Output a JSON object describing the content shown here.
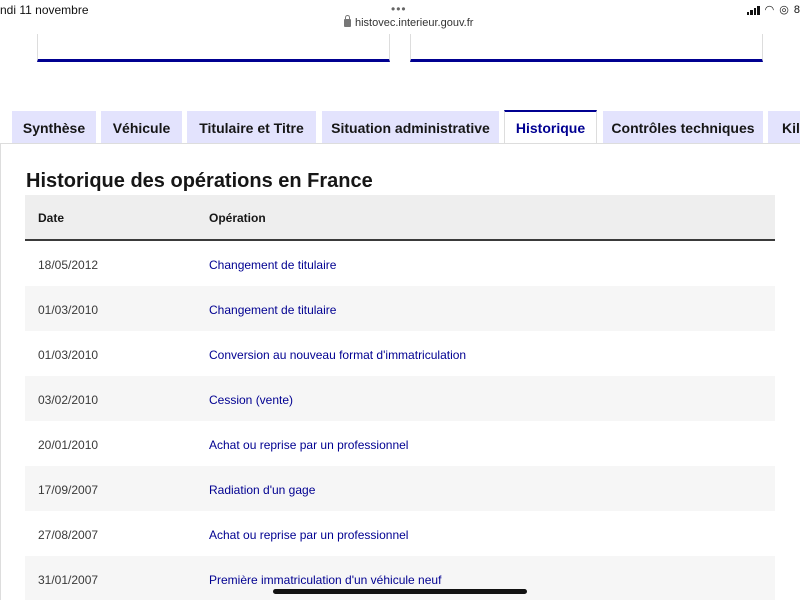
{
  "status_bar": {
    "date": "ndi 11 novembre",
    "dots": "•••",
    "url": "histovec.interieur.gouv.fr",
    "battery_text": "8"
  },
  "tabs": [
    {
      "label": "Synthèse",
      "active": false
    },
    {
      "label": "Véhicule",
      "active": false
    },
    {
      "label": "Titulaire et Titre",
      "active": false
    },
    {
      "label": "Situation administrative",
      "active": false
    },
    {
      "label": "Historique",
      "active": true
    },
    {
      "label": "Contrôles techniques",
      "active": false
    },
    {
      "label": "Kilo",
      "active": false
    }
  ],
  "section": {
    "title": "Historique des opérations en France"
  },
  "table": {
    "headers": [
      "Date",
      "Opération"
    ],
    "rows": [
      {
        "date": "18/05/2012",
        "operation": "Changement de titulaire"
      },
      {
        "date": "01/03/2010",
        "operation": "Changement de titulaire"
      },
      {
        "date": "01/03/2010",
        "operation": "Conversion au nouveau format d'immatriculation"
      },
      {
        "date": "03/02/2010",
        "operation": "Cession (vente)"
      },
      {
        "date": "20/01/2010",
        "operation": "Achat ou reprise par un professionnel"
      },
      {
        "date": "17/09/2007",
        "operation": "Radiation d'un gage"
      },
      {
        "date": "27/08/2007",
        "operation": "Achat ou reprise par un professionnel"
      },
      {
        "date": "31/01/2007",
        "operation": "Première immatriculation d'un véhicule neuf"
      }
    ]
  },
  "colors": {
    "accent": "#000091",
    "tab_bg": "#e3e3fd",
    "header_bg": "#eeeeee",
    "row_alt_bg": "#f6f6f6"
  }
}
